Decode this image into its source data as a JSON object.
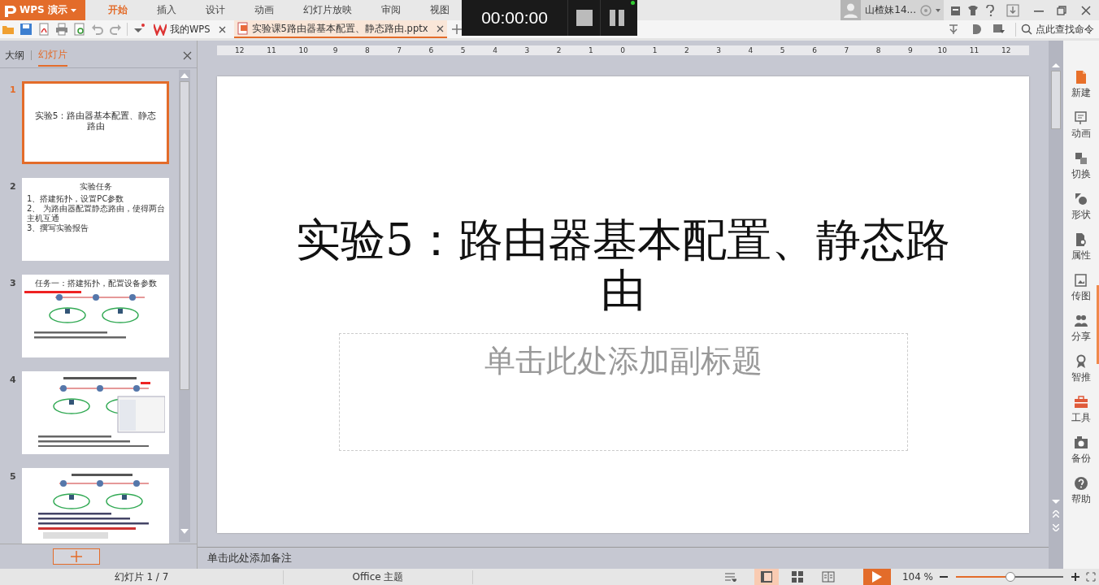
{
  "app_button": {
    "label": "WPS 演示"
  },
  "menu_tabs": [
    {
      "label": "开始",
      "selected": true
    },
    {
      "label": "插入",
      "selected": false
    },
    {
      "label": "设计",
      "selected": false
    },
    {
      "label": "动画",
      "selected": false
    },
    {
      "label": "幻灯片放映",
      "selected": false
    },
    {
      "label": "审阅",
      "selected": false
    },
    {
      "label": "视图",
      "selected": false
    }
  ],
  "timer": {
    "time": "00:00:00"
  },
  "user": {
    "name": "山楂妹14..."
  },
  "doc_tabs": [
    {
      "label": "我的WPS",
      "selected": false,
      "kind": "home"
    },
    {
      "label": "实验课5路由器基本配置、静态路由.pptx",
      "selected": true,
      "kind": "file"
    }
  ],
  "search": {
    "placeholder": "点此查找命令"
  },
  "panel_tabs": [
    {
      "label": "大纲",
      "selected": false
    },
    {
      "label": "幻灯片",
      "selected": true
    }
  ],
  "thumbnails": [
    {
      "number": "1",
      "selected": true,
      "kind": "title",
      "title": "实验5：路由器基本配置、静态路由"
    },
    {
      "number": "2",
      "selected": false,
      "kind": "bullets",
      "title": "实验任务",
      "bullets": [
        "1、搭建拓扑，设置PC参数",
        "2、 为路由器配置静态路由，使得两台主机互通",
        "3、撰写实验报告"
      ]
    },
    {
      "number": "3",
      "selected": false,
      "kind": "topology",
      "title": "任务一：搭建拓扑，配置设备参数"
    },
    {
      "number": "4",
      "selected": false,
      "kind": "screenshot"
    },
    {
      "number": "5",
      "selected": false,
      "kind": "routes"
    }
  ],
  "ruler_labels": [
    "12",
    "11",
    "10",
    "9",
    "8",
    "7",
    "6",
    "5",
    "4",
    "3",
    "2",
    "1",
    "0",
    "1",
    "2",
    "3",
    "4",
    "5",
    "6",
    "7",
    "8",
    "9",
    "10",
    "11",
    "12"
  ],
  "slide": {
    "title": "实验5：路由器基本配置、静态路由",
    "subtitle_placeholder": "单击此处添加副标题"
  },
  "notes": {
    "placeholder": "单击此处添加备注"
  },
  "side_tools": [
    {
      "label": "新建",
      "kind": "new"
    },
    {
      "label": "动画",
      "kind": "animation"
    },
    {
      "label": "切换",
      "kind": "transition"
    },
    {
      "label": "形状",
      "kind": "shape"
    },
    {
      "label": "属性",
      "kind": "property"
    },
    {
      "label": "传图",
      "kind": "image"
    },
    {
      "label": "分享",
      "kind": "share"
    },
    {
      "label": "智推",
      "kind": "recommend"
    },
    {
      "label": "工具",
      "kind": "tools"
    },
    {
      "label": "备份",
      "kind": "backup"
    },
    {
      "label": "帮助",
      "kind": "help"
    }
  ],
  "view_buttons": [
    {
      "kind": "normal",
      "selected": true
    },
    {
      "kind": "sorter",
      "selected": false
    },
    {
      "kind": "reading",
      "selected": false
    }
  ],
  "status": {
    "slide_counter": "幻灯片 1 / 7",
    "theme": "Office 主题",
    "zoom": "104 %",
    "level": 0.51
  }
}
